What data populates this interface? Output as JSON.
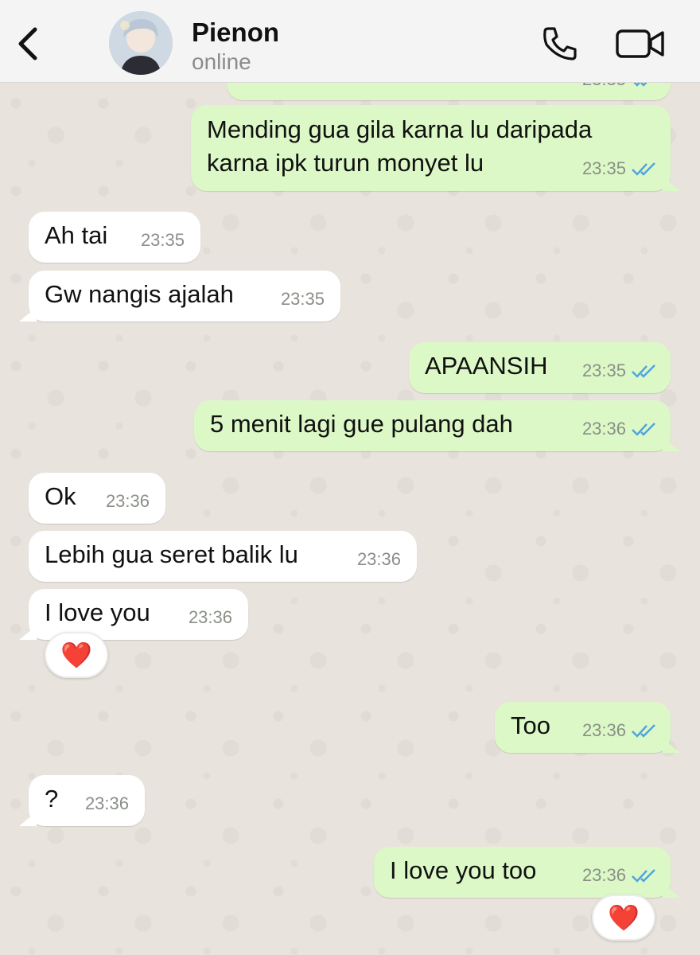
{
  "header": {
    "contact_name": "Pienon",
    "status": "online"
  },
  "messages": [
    {
      "direction": "out",
      "text": "",
      "time": "23:35",
      "partial": true
    },
    {
      "direction": "out",
      "text": "Mending gua gila karna lu daripada\nkarna ipk turun monyet lu",
      "time": "23:35"
    },
    {
      "direction": "in",
      "text": "Ah tai",
      "time": "23:35"
    },
    {
      "direction": "in",
      "text": "Gw nangis ajalah",
      "time": "23:35"
    },
    {
      "direction": "out",
      "text": "APAANSIH",
      "time": "23:35"
    },
    {
      "direction": "out",
      "text": "5 menit lagi gue pulang dah",
      "time": "23:36"
    },
    {
      "direction": "in",
      "text": "Ok",
      "time": "23:36"
    },
    {
      "direction": "in",
      "text": "Lebih gua seret balik lu",
      "time": "23:36"
    },
    {
      "direction": "in",
      "text": "I love you",
      "time": "23:36",
      "reaction": "❤️"
    },
    {
      "direction": "out",
      "text": "Too",
      "time": "23:36"
    },
    {
      "direction": "in",
      "text": "?",
      "time": "23:36"
    },
    {
      "direction": "out",
      "text": "I love you too",
      "time": "23:36",
      "reaction": "❤️"
    }
  ],
  "colors": {
    "outgoing_bubble": "#dcf8c6",
    "incoming_bubble": "#ffffff",
    "read_ticks": "#4fa3e0",
    "icon": "#111111"
  },
  "icons": {
    "back": "chevron-left-icon",
    "call": "phone-icon",
    "video": "video-camera-icon",
    "read_receipt": "double-check-icon"
  }
}
